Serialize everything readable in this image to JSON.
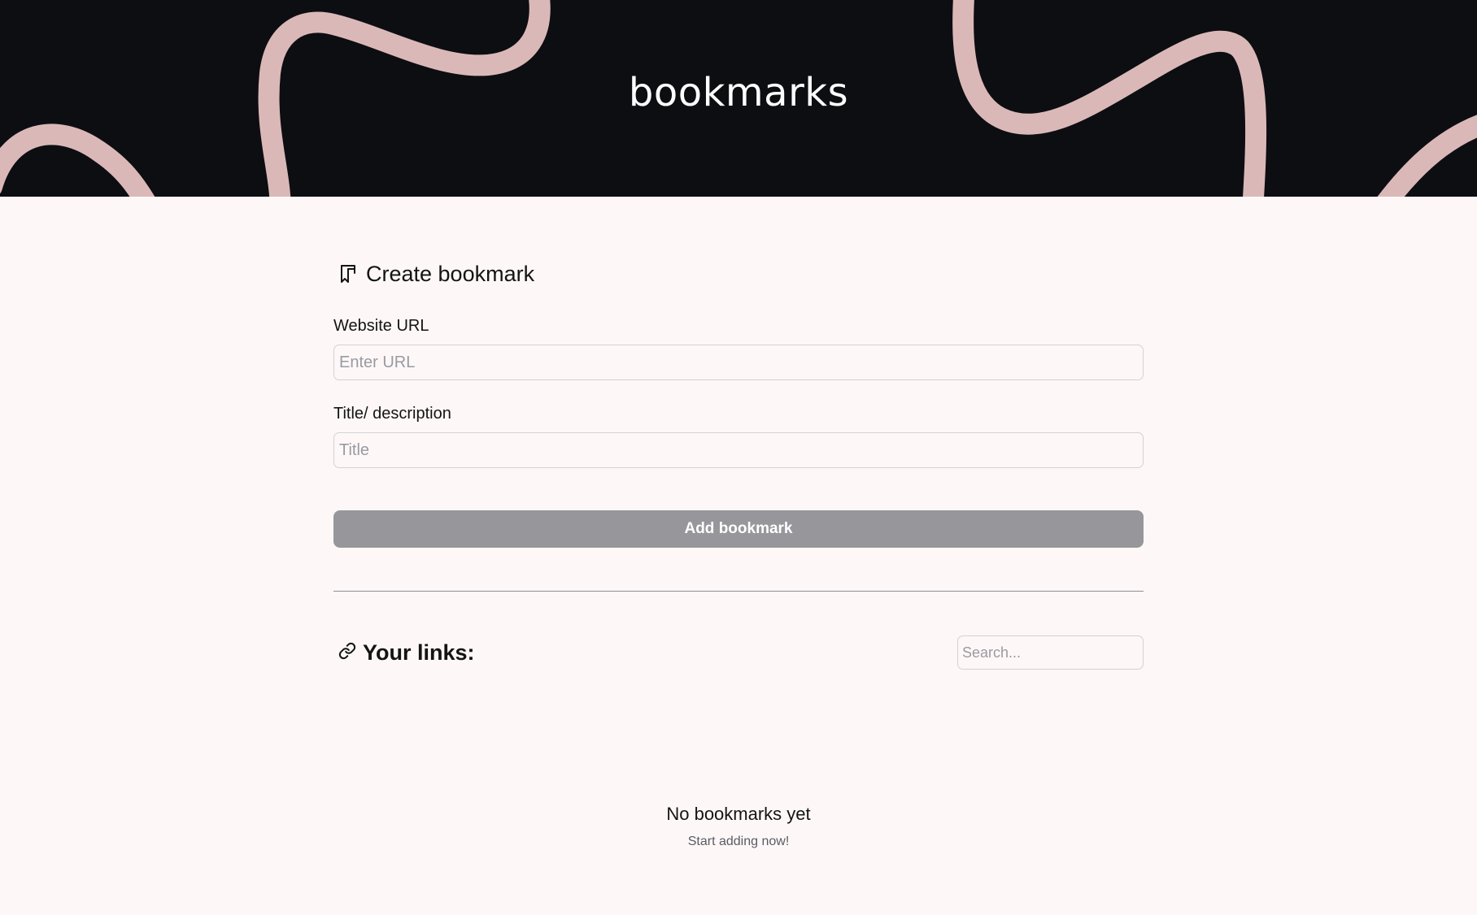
{
  "header": {
    "brand": "bookmarks",
    "background_color": "#0d0e12",
    "squiggle_color": "#dbb8b8"
  },
  "create": {
    "title": "Create bookmark",
    "icon": "bookmark-icon",
    "url_label": "Website URL",
    "url_placeholder": "Enter URL",
    "url_value": "",
    "title_label": "Title/ description",
    "title_placeholder": "Title",
    "title_value": "",
    "submit_label": "Add bookmark"
  },
  "links": {
    "title": "Your links:",
    "icon": "link-icon",
    "search_placeholder": "Search...",
    "search_value": ""
  },
  "empty_state": {
    "title": "No bookmarks yet",
    "subtitle": "Start adding now!"
  },
  "colors": {
    "page_background": "#fdf8f7",
    "button_background": "#97979b",
    "button_text": "#ffffff"
  }
}
